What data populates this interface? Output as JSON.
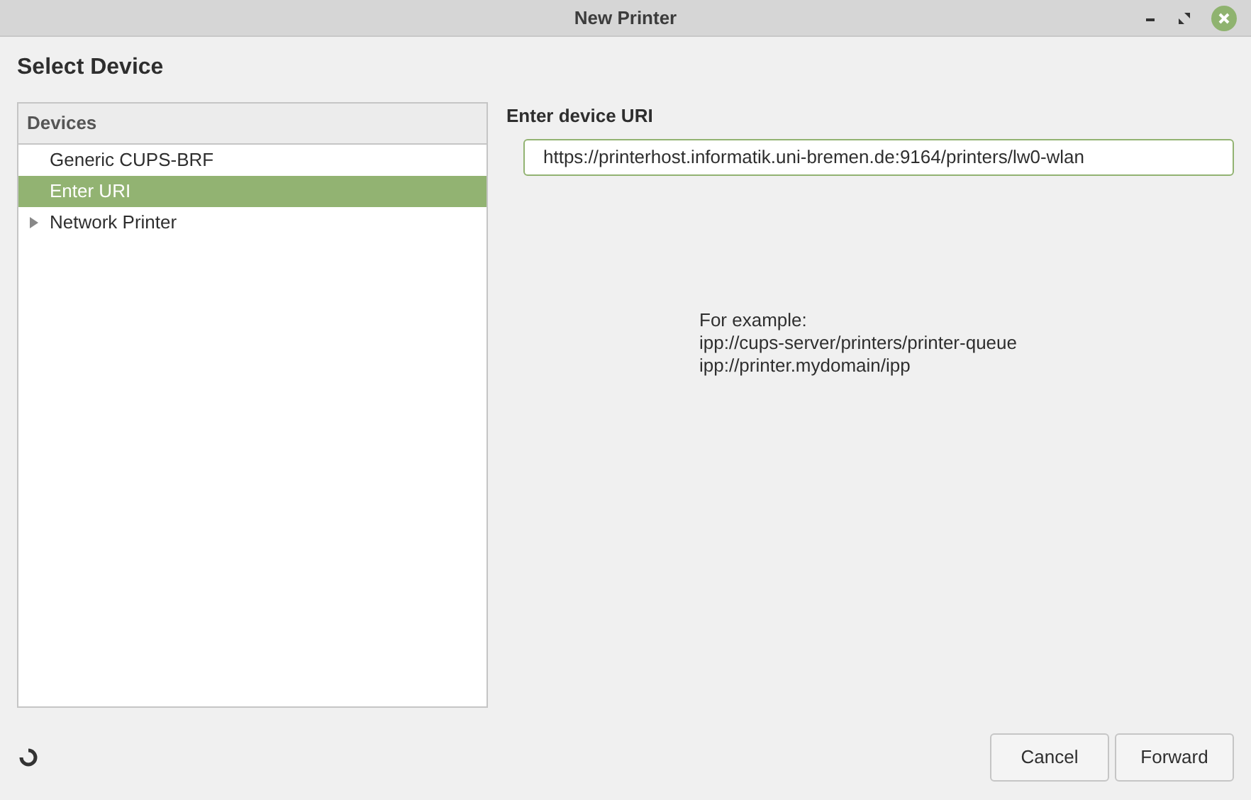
{
  "window": {
    "title": "New Printer"
  },
  "heading": "Select Device",
  "devices": {
    "header": "Devices",
    "items": [
      {
        "label": "Generic CUPS-BRF",
        "kind": "device",
        "selected": false
      },
      {
        "label": "Enter URI",
        "kind": "device",
        "selected": true
      },
      {
        "label": "Network Printer",
        "kind": "group",
        "expanded": false,
        "selected": false
      }
    ]
  },
  "uri": {
    "label": "Enter device URI",
    "value": "https://printerhost.informatik.uni-bremen.de:9164/printers/lw0-wlan"
  },
  "example_lines": [
    "For example:",
    "ipp://cups-server/printers/printer-queue",
    "ipp://printer.mydomain/ipp"
  ],
  "buttons": [
    "Cancel",
    "Forward"
  ]
}
